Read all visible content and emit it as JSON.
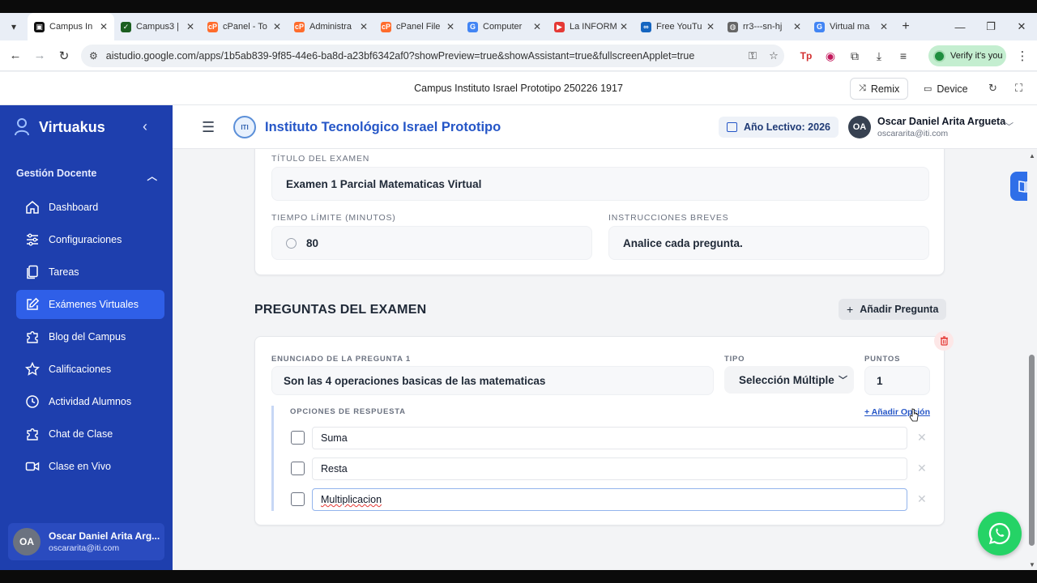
{
  "browser": {
    "tabs": [
      {
        "label": "Campus In",
        "color": "#111111",
        "glyph": "▣",
        "active": true
      },
      {
        "label": "Campus3 |",
        "color": "#1b5e20",
        "glyph": "✓"
      },
      {
        "label": "cPanel - To",
        "color": "#ff6c2c",
        "glyph": "cP"
      },
      {
        "label": "Administra",
        "color": "#ff6c2c",
        "glyph": "cP"
      },
      {
        "label": "cPanel File",
        "color": "#ff6c2c",
        "glyph": "cP"
      },
      {
        "label": "Computer",
        "color": "#4285f4",
        "glyph": "G"
      },
      {
        "label": "La INFORM",
        "color": "#e53935",
        "glyph": "▶"
      },
      {
        "label": "Free YouTu",
        "color": "#1565c0",
        "glyph": "∞"
      },
      {
        "label": "rr3---sn-hj",
        "color": "#666666",
        "glyph": "◍"
      },
      {
        "label": "Virtual ma",
        "color": "#4285f4",
        "glyph": "G"
      }
    ],
    "url": "aistudio.google.com/apps/1b5ab839-9f85-44e6-ba8d-a23bf6342af0?showPreview=true&showAssistant=true&fullscreenApplet=true",
    "verify_label": "Verify it's you"
  },
  "aistudio": {
    "project_title": "Campus Instituto Israel Prototipo 250226 1917",
    "remix_label": "Remix",
    "device_label": "Device"
  },
  "sidebar": {
    "brand": "Virtuakus",
    "section": "Gestión Docente",
    "items": [
      {
        "label": "Dashboard",
        "icon": "home-icon"
      },
      {
        "label": "Configuraciones",
        "icon": "sliders-icon"
      },
      {
        "label": "Tareas",
        "icon": "document-icon"
      },
      {
        "label": "Exámenes Virtuales",
        "icon": "edit-icon",
        "active": true
      },
      {
        "label": "Blog del Campus",
        "icon": "puzzle-icon"
      },
      {
        "label": "Calificaciones",
        "icon": "star-icon"
      },
      {
        "label": "Actividad Alumnos",
        "icon": "clock-icon"
      },
      {
        "label": "Chat de Clase",
        "icon": "puzzle-icon"
      },
      {
        "label": "Clase en Vivo",
        "icon": "video-icon"
      }
    ],
    "user": {
      "initials": "OA",
      "name": "Oscar Daniel Arita Arg...",
      "email": "oscararita@iti.com"
    }
  },
  "header": {
    "institution": "Instituto Tecnológico Israel Prototipo",
    "logo_text": "ITI",
    "year": "Año Lectivo: 2026",
    "user": {
      "initials": "OA",
      "name": "Oscar Daniel Arita Argueta",
      "email": "oscararita@iti.com"
    }
  },
  "exam": {
    "title_label": "Título del Examen",
    "title_value": "Examen 1 Parcial Matematicas Virtual",
    "time_label": "Tiempo Límite (Minutos)",
    "time_value": "80",
    "instructions_label": "Instrucciones Breves",
    "instructions_value": "Analice cada pregunta."
  },
  "questions": {
    "section_title": "PREGUNTAS DEL EXAMEN",
    "add_label": "Añadir Pregunta",
    "q1": {
      "statement_label": "Enunciado de la Pregunta 1",
      "statement_value": "Son las 4 operaciones basicas de las matematicas",
      "type_label": "Tipo",
      "type_value": "Selección Múltiple",
      "points_label": "Puntos",
      "points_value": "1",
      "options_label": "Opciones de Respuesta",
      "add_option_label": "+ Añadir Opción",
      "options": [
        "Suma",
        "Resta",
        "Multiplicacion"
      ]
    }
  },
  "colors": {
    "sidebar": "#1e3fae",
    "active_nav": "#2f5fe8",
    "accent": "#2556c7",
    "whatsapp": "#25d366"
  }
}
